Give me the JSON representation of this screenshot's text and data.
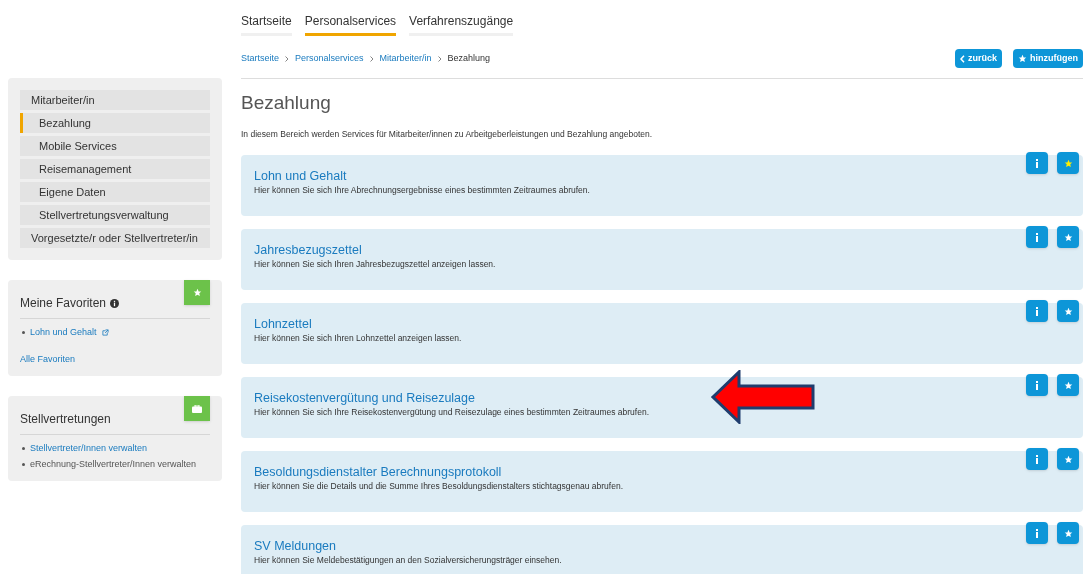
{
  "tabs": [
    {
      "label": "Startseite",
      "selected": false
    },
    {
      "label": "Personalservices",
      "selected": true
    },
    {
      "label": "Verfahrenszugänge",
      "selected": false
    }
  ],
  "breadcrumb": [
    "Startseite",
    "Personalservices",
    "Mitarbeiter/in",
    "Bezahlung"
  ],
  "actions": [
    {
      "label": "zurück",
      "kind": "back"
    },
    {
      "label": "hinzufügen",
      "kind": "favorite"
    }
  ],
  "sidebar": {
    "items": [
      {
        "label": "Mitarbeiter/in",
        "selected": false,
        "children": [
          {
            "label": "Bezahlung",
            "selected": true
          },
          {
            "label": "Mobile Services",
            "selected": false
          },
          {
            "label": "Reisemanagement",
            "selected": false
          },
          {
            "label": "Eigene Daten",
            "selected": false
          },
          {
            "label": "Stellvertretungsverwaltung",
            "selected": false
          }
        ]
      },
      {
        "label": "Vorgesetzte/r oder Stellvertreter/in",
        "selected": false
      }
    ],
    "panels": [
      {
        "title": "Meine Favoriten",
        "kind": "favorites",
        "links": [
          {
            "label": "Lohn und Gehalt",
            "kind": "external"
          }
        ],
        "footer": "Alle Favoriten"
      },
      {
        "title": "Stellvertretungen",
        "kind": "substitutes",
        "links": [
          {
            "label": "Stellvertreter/Innen verwalten",
            "kind": "link"
          },
          {
            "label": "eRechnung-Stellvertreter/Innen verwalten",
            "kind": "text"
          }
        ]
      }
    ]
  },
  "page": {
    "title": "Bezahlung",
    "intro": "In diesem Bereich werden Services für Mitarbeiter/innen zu Arbeitgeberleistungen und Bezahlung angeboten."
  },
  "services": [
    {
      "title": "Lohn und Gehalt",
      "description": "Hier können Sie sich Ihre Abrechnungsergebnisse eines bestimmten Zeitraumes abrufen.",
      "favorite": true,
      "highlighted": false
    },
    {
      "title": "Jahresbezugszettel",
      "description": "Hier können Sie sich Ihren Jahresbezugszettel anzeigen lassen.",
      "favorite": false,
      "highlighted": false
    },
    {
      "title": "Lohnzettel",
      "description": "Hier können Sie sich Ihren Lohnzettel anzeigen lassen.",
      "favorite": false,
      "highlighted": false
    },
    {
      "title": "Reisekostenvergütung und Reisezulage",
      "description": "Hier können Sie sich Ihre Reisekostenvergütung und Reisezulage eines bestimmten Zeitraumes abrufen.",
      "favorite": false,
      "highlighted": true
    },
    {
      "title": "Besoldungsdienstalter Berechnungsprotokoll",
      "description": "Hier können Sie die Details und die Summe Ihres Besoldungsdienstalters stichtagsgenau abrufen.",
      "favorite": false,
      "highlighted": false
    },
    {
      "title": "SV Meldungen",
      "description": "Hier können Sie Meldebestätigungen an den Sozialversicherungsträger einsehen.",
      "favorite": false,
      "highlighted": false
    }
  ]
}
